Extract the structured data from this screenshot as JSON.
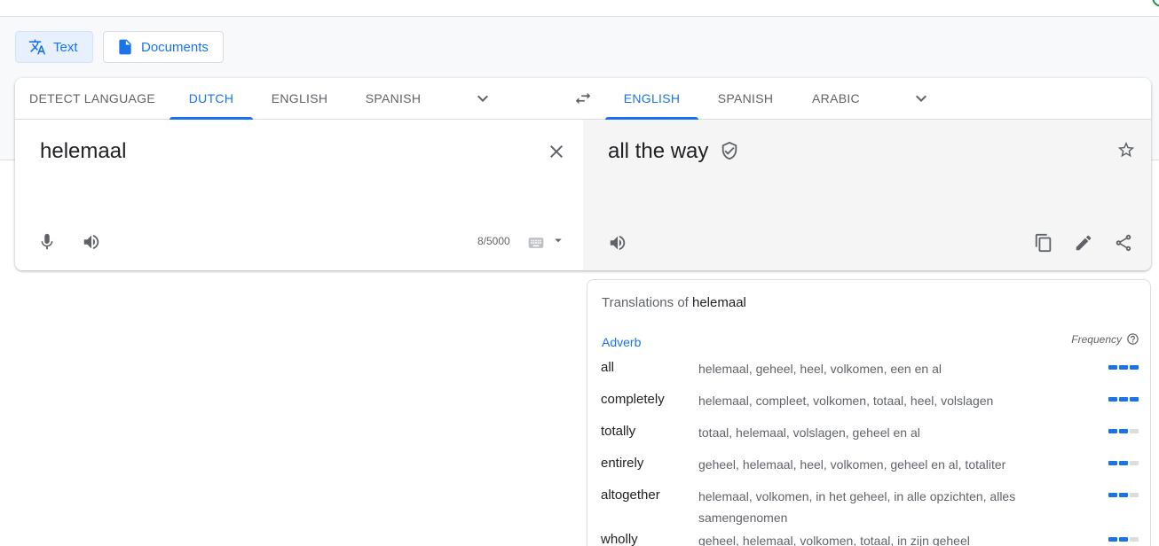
{
  "mode_buttons": {
    "text_label": "Text",
    "documents_label": "Documents"
  },
  "source_tabs": [
    "DETECT LANGUAGE",
    "DUTCH",
    "ENGLISH",
    "SPANISH"
  ],
  "source_active": "DUTCH",
  "target_tabs": [
    "ENGLISH",
    "SPANISH",
    "ARABIC"
  ],
  "target_active": "ENGLISH",
  "source": {
    "text": "helemaal",
    "char_count": "8/5000"
  },
  "target": {
    "text": "all the way"
  },
  "dictionary": {
    "title_prefix": "Translations of",
    "title_word": "helemaal",
    "part_of_speech": "Adverb",
    "frequency_label": "Frequency",
    "entries": [
      {
        "word": "all",
        "synonyms": "helemaal, geheel, heel, volkomen, een en al",
        "frequency": 3
      },
      {
        "word": "completely",
        "synonyms": "helemaal, compleet, volkomen, totaal, heel, volslagen",
        "frequency": 3
      },
      {
        "word": "totally",
        "synonyms": "totaal, helemaal, volslagen, geheel en al",
        "frequency": 2
      },
      {
        "word": "entirely",
        "synonyms": "geheel, helemaal, heel, volkomen, geheel en al, totaliter",
        "frequency": 2
      },
      {
        "word": "altogether",
        "synonyms": "helemaal, volkomen, in het geheel, in alle opzichten, alles samengenomen",
        "frequency": 2
      },
      {
        "word": "wholly",
        "synonyms": "geheel, helemaal, volkomen, totaal, in zijn geheel",
        "frequency": 2
      }
    ]
  },
  "colors": {
    "accent": "#1a73e8",
    "muted": "#5f6368",
    "target_bg": "#f5f5f5"
  }
}
